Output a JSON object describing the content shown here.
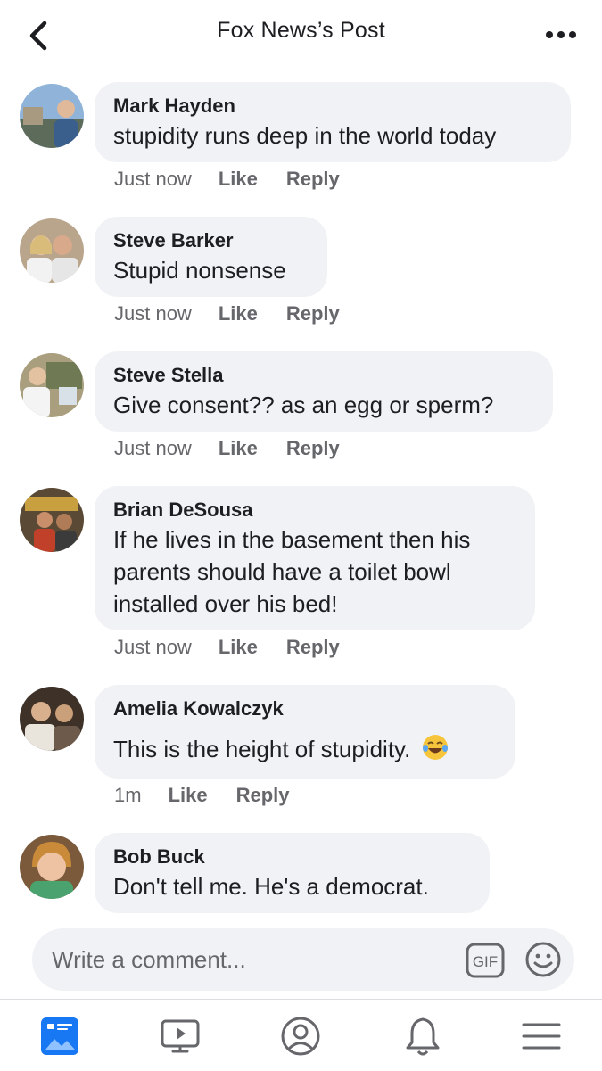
{
  "header": {
    "title": "Fox News’s Post"
  },
  "comments": [
    {
      "author": "Mark Hayden",
      "text": "stupidity runs deep in the world today",
      "time": "Just now",
      "like": "Like",
      "reply": "Reply"
    },
    {
      "author": "Steve Barker",
      "text": "Stupid nonsense",
      "time": "Just now",
      "like": "Like",
      "reply": "Reply"
    },
    {
      "author": "Steve Stella",
      "text": "Give consent?? as an egg or sperm?",
      "time": "Just now",
      "like": "Like",
      "reply": "Reply"
    },
    {
      "author": "Brian DeSousa",
      "text": "If he lives in the basement then his parents should have a toilet bowl installed over his bed!",
      "time": "Just now",
      "like": "Like",
      "reply": "Reply"
    },
    {
      "author": "Amelia Kowalczyk",
      "text": "This is the height of stupidity.",
      "emoji": "tears-of-joy-emoji",
      "time": "1m",
      "like": "Like",
      "reply": "Reply"
    },
    {
      "author": "Bob Buck",
      "text": "Don't tell me. He's a democrat."
    }
  ],
  "composer": {
    "placeholder": "Write a comment...",
    "gif_label": "GIF",
    "emoji_icon": "smiley-icon"
  },
  "tabbar": {
    "items": [
      "news-feed-icon",
      "watch-icon",
      "profile-icon",
      "notifications-icon",
      "menu-icon"
    ],
    "active_color": "#1877f2"
  },
  "colors": {
    "bubble": "#f0f2f5",
    "secondary_text": "#65676b",
    "primary_text": "#1c1e21"
  }
}
